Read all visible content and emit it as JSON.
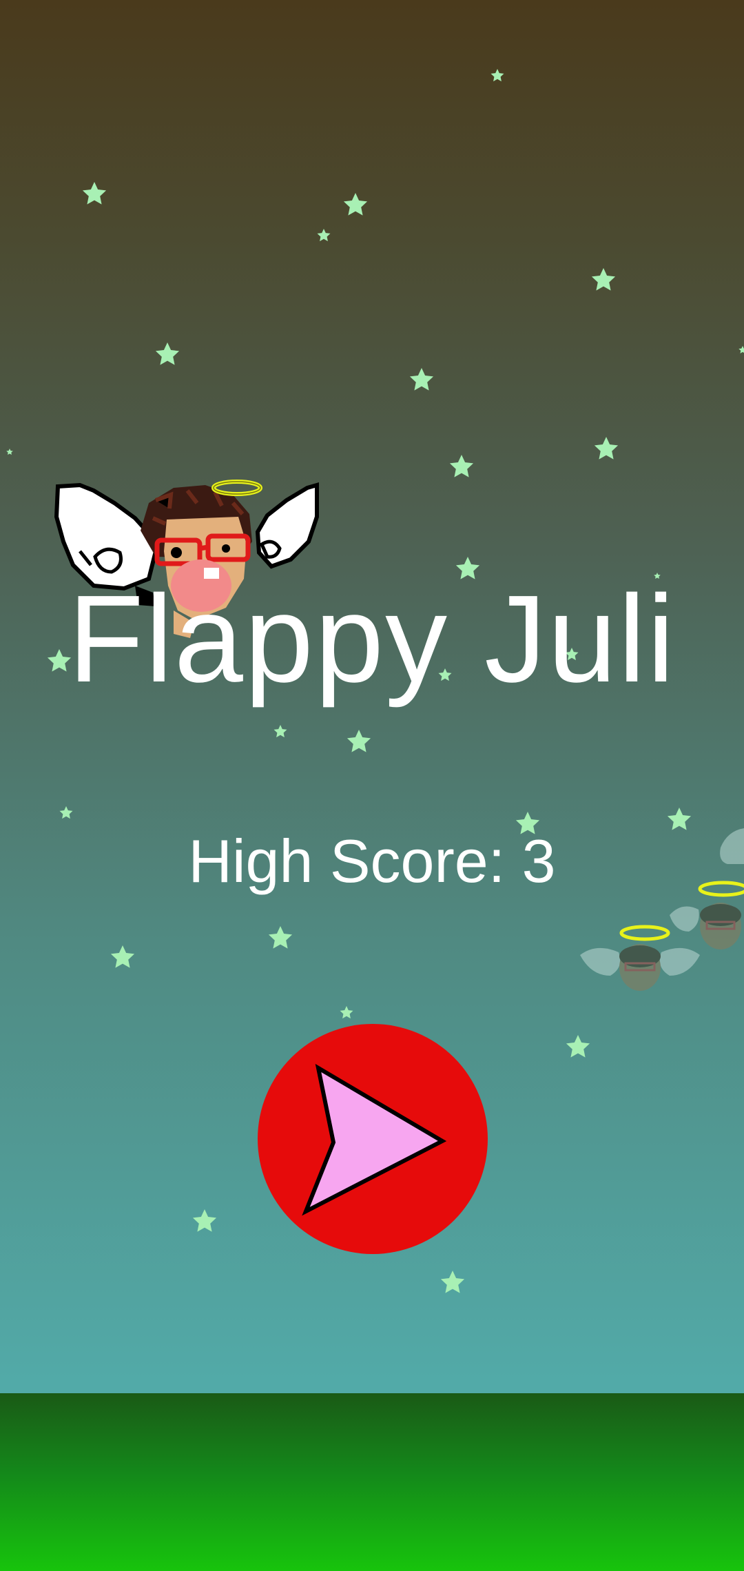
{
  "game": {
    "title": "Flappy Juli",
    "high_score_text": "High Score: 3"
  },
  "icons": {
    "play": "play-triangle-icon",
    "star": "star-icon",
    "player": "winged-angel-character",
    "halo": "halo-icon"
  },
  "colors": {
    "sky_top": "#4a3a1c",
    "sky_bottom": "#52aaa8",
    "ground_top": "#1a5a16",
    "ground_bottom": "#17c40c",
    "star": "#a8f0b4",
    "title_text": "#ffffff",
    "play_circle": "#e60b0b",
    "play_triangle": "#f7a6f0",
    "halo": "#e8f21a"
  }
}
